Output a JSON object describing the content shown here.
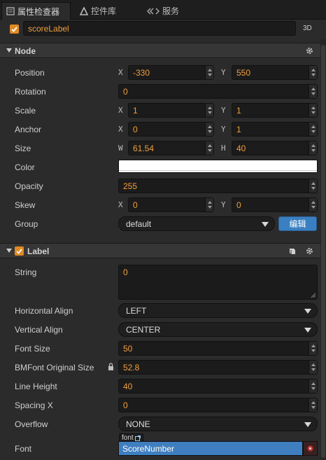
{
  "tabs": [
    {
      "label": "属性检查器"
    },
    {
      "label": "控件库"
    },
    {
      "label": "服务"
    }
  ],
  "node_name": "scoreLabel",
  "mode_3d": "3D",
  "node_section": {
    "title": "Node"
  },
  "props": {
    "position": {
      "label": "Position",
      "x_axis": "X",
      "x": "-330",
      "y_axis": "Y",
      "y": "550"
    },
    "rotation": {
      "label": "Rotation",
      "value": "0"
    },
    "scale": {
      "label": "Scale",
      "x_axis": "X",
      "x": "1",
      "y_axis": "Y",
      "y": "1"
    },
    "anchor": {
      "label": "Anchor",
      "x_axis": "X",
      "x": "0",
      "y_axis": "Y",
      "y": "1"
    },
    "size": {
      "label": "Size",
      "w_axis": "W",
      "w": "61.54",
      "h_axis": "H",
      "h": "40"
    },
    "color": {
      "label": "Color",
      "value": "#ffffff"
    },
    "opacity": {
      "label": "Opacity",
      "value": "255"
    },
    "skew": {
      "label": "Skew",
      "x_axis": "X",
      "x": "0",
      "y_axis": "Y",
      "y": "0"
    },
    "group": {
      "label": "Group",
      "value": "default",
      "edit": "编辑"
    }
  },
  "label_section": {
    "title": "Label"
  },
  "label_props": {
    "string": {
      "label": "String",
      "value": "0"
    },
    "h_align": {
      "label": "Horizontal Align",
      "value": "LEFT"
    },
    "v_align": {
      "label": "Vertical Align",
      "value": "CENTER"
    },
    "font_size": {
      "label": "Font Size",
      "value": "50"
    },
    "bmfont": {
      "label": "BMFont Original Size",
      "value": "52.8"
    },
    "line_height": {
      "label": "Line Height",
      "value": "40"
    },
    "spacing_x": {
      "label": "Spacing X",
      "value": "0"
    },
    "overflow": {
      "label": "Overflow",
      "value": "NONE"
    },
    "font": {
      "label": "Font",
      "tag": "font",
      "value": "ScoreNumber"
    }
  },
  "colors": {
    "accent": "#e18a24",
    "value_text": "#f29f3c",
    "edit_button": "#3a7fc1",
    "font_asset": "#3f7fbf"
  }
}
